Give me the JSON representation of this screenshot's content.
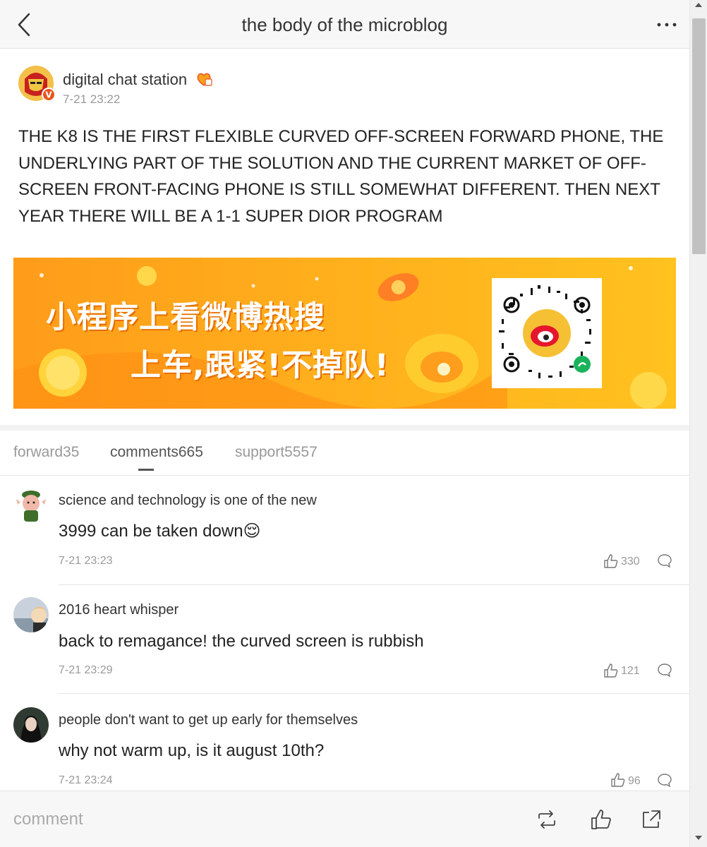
{
  "header": {
    "title": "the body of the microblog"
  },
  "post": {
    "author": "digital chat station",
    "time": "7-21 23:22",
    "text": "THE K8 IS THE FIRST FLEXIBLE CURVED OFF-SCREEN FORWARD PHONE, THE UNDERLYING PART OF THE SOLUTION AND THE CURRENT MARKET OF OFF-SCREEN FRONT-FACING PHONE IS STILL SOMEWHAT DIFFERENT. THEN NEXT YEAR THERE WILL BE A 1-1 SUPER DIOR PROGRAM",
    "banner": {
      "line1": "小程序上看微博热搜",
      "line2": "上车,跟紧!不掉队!"
    }
  },
  "tabs": {
    "forward": "forward35",
    "comments": "comments665",
    "support": "support5557"
  },
  "comments": [
    {
      "user": "science and technology is one of the new",
      "text": "3999 can be taken down😌",
      "time": "7-21 23:23",
      "likes": "330"
    },
    {
      "user": "2016 heart whisper",
      "text": "back to remagance! the curved screen is rubbish",
      "time": "7-21 23:29",
      "likes": "121"
    },
    {
      "user": "people don't want to get up early for themselves",
      "text": "why not warm up, is it august 10th?",
      "time": "7-21 23:24",
      "likes": "96"
    }
  ],
  "bottom": {
    "comment_placeholder": "comment"
  },
  "colors": {
    "banner_orange": "#ff9c1a",
    "text_gray": "#999999",
    "verified_badge": "#e8541e"
  },
  "icons": {
    "back": "chevron-left-icon",
    "more": "more-dots-icon",
    "like": "thumbs-up-icon",
    "reply": "comment-bubble-icon",
    "repost": "repost-icon",
    "share": "share-icon"
  }
}
